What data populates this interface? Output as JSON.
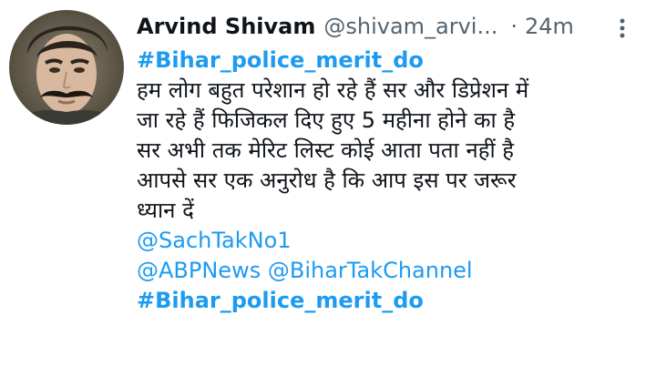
{
  "tweet": {
    "author": {
      "display_name": "Arvind Shivam",
      "handle": "@shivam_arvi...",
      "time_separator": "·",
      "timestamp": "24m"
    },
    "hashtag_top": "#Bihar_police_merit_do",
    "text_lines": [
      "हम लोग बहुत परेशान हो रहे हैं सर और डिप्रेशन में",
      "जा रहे हैं फिजिकल दिए हुए 5 महीना होने का है",
      "सर अभी तक मेरिट लिस्ट कोई आता पता नहीं है",
      "आपसे सर एक अनुरोध है कि आप इस पर जरूर",
      "ध्यान दें"
    ],
    "mentions": [
      "@SachTakNo1",
      "@ABPNews",
      "@BiharTakChannel"
    ],
    "hashtag_bottom": "#Bihar_police_merit_do"
  },
  "colors": {
    "link": "#1d9bf0",
    "text": "#0f1419",
    "secondary": "#536471"
  },
  "icons": {
    "avatar": "profile-photo",
    "more": "vertical-ellipsis-icon"
  }
}
